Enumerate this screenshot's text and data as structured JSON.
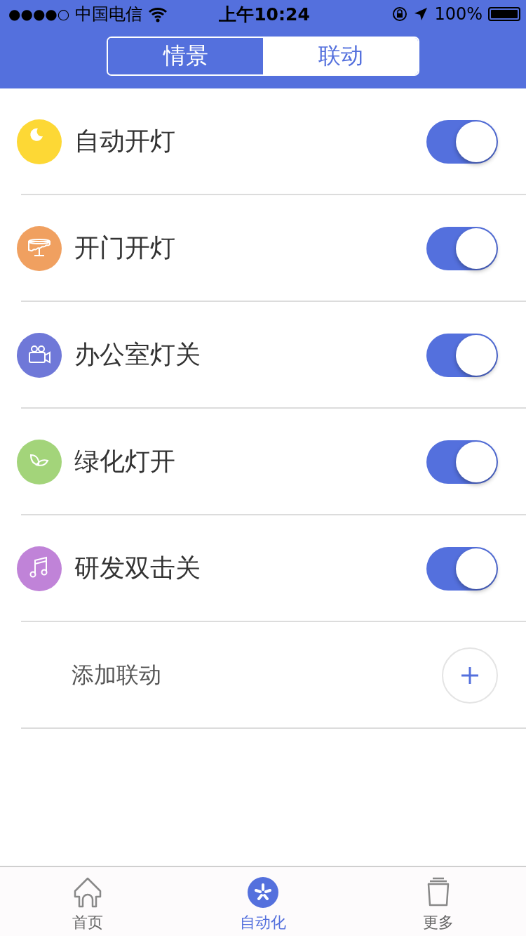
{
  "status_bar": {
    "signal": "●●●●○",
    "carrier": "中国电信",
    "time": "上午10:24",
    "battery": "100%"
  },
  "segments": [
    {
      "label": "情景",
      "selected": true
    },
    {
      "label": "联动",
      "selected": false
    }
  ],
  "automations": [
    {
      "name": "自动开灯",
      "kind": "moon",
      "color": "#fdd835",
      "on": true
    },
    {
      "name": "开门开灯",
      "kind": "table",
      "color": "#f0a060",
      "on": true
    },
    {
      "name": "办公室灯关",
      "kind": "camera",
      "color": "#6f78d8",
      "on": true
    },
    {
      "name": "绿化灯开",
      "kind": "leaf",
      "color": "#a3d47a",
      "on": true
    },
    {
      "name": "研发双击关",
      "kind": "music",
      "color": "#c083d8",
      "on": true
    }
  ],
  "add_item": {
    "label": "添加联动"
  },
  "tab_bar": [
    {
      "label": "首页",
      "kind": "home",
      "selected": false
    },
    {
      "label": "自动化",
      "kind": "auto",
      "selected": true
    },
    {
      "label": "更多",
      "kind": "more",
      "selected": false
    }
  ]
}
